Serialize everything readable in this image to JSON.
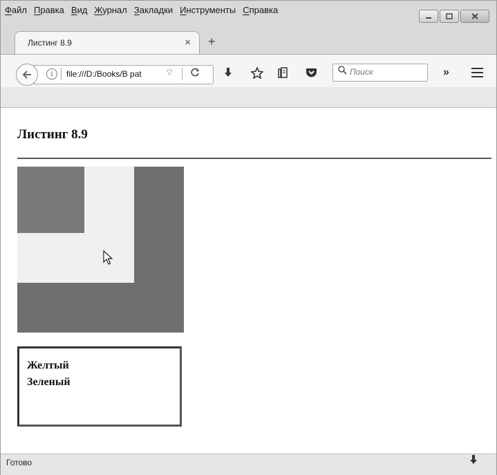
{
  "menu": {
    "items": [
      "Файл",
      "Правка",
      "Вид",
      "Журнал",
      "Закладки",
      "Инструменты",
      "Справка"
    ]
  },
  "tab": {
    "title": "Листинг 8.9",
    "close": "×",
    "new_tab": "+"
  },
  "navbar": {
    "url": "file:///D:/Books/В раt",
    "url_dropdown": "▽",
    "reload": "C",
    "search_placeholder": "Поиск",
    "overflow": "»"
  },
  "page": {
    "title": "Листинг 8.9",
    "textbox_lines": [
      "Желтый",
      "Зеленый"
    ]
  },
  "status": {
    "text": "Готово"
  },
  "colors": {
    "outer_square": "#6f6f6f",
    "middle_square": "#f0f0f0",
    "inner_square": "#7a7a7a"
  },
  "icons": {
    "back": "back-arrow-icon",
    "info": "info-icon",
    "reload": "reload-icon",
    "download": "download-icon",
    "bookmark": "star-icon",
    "library": "library-icon",
    "pocket": "pocket-icon",
    "search": "search-icon",
    "menu": "hamburger-icon"
  }
}
